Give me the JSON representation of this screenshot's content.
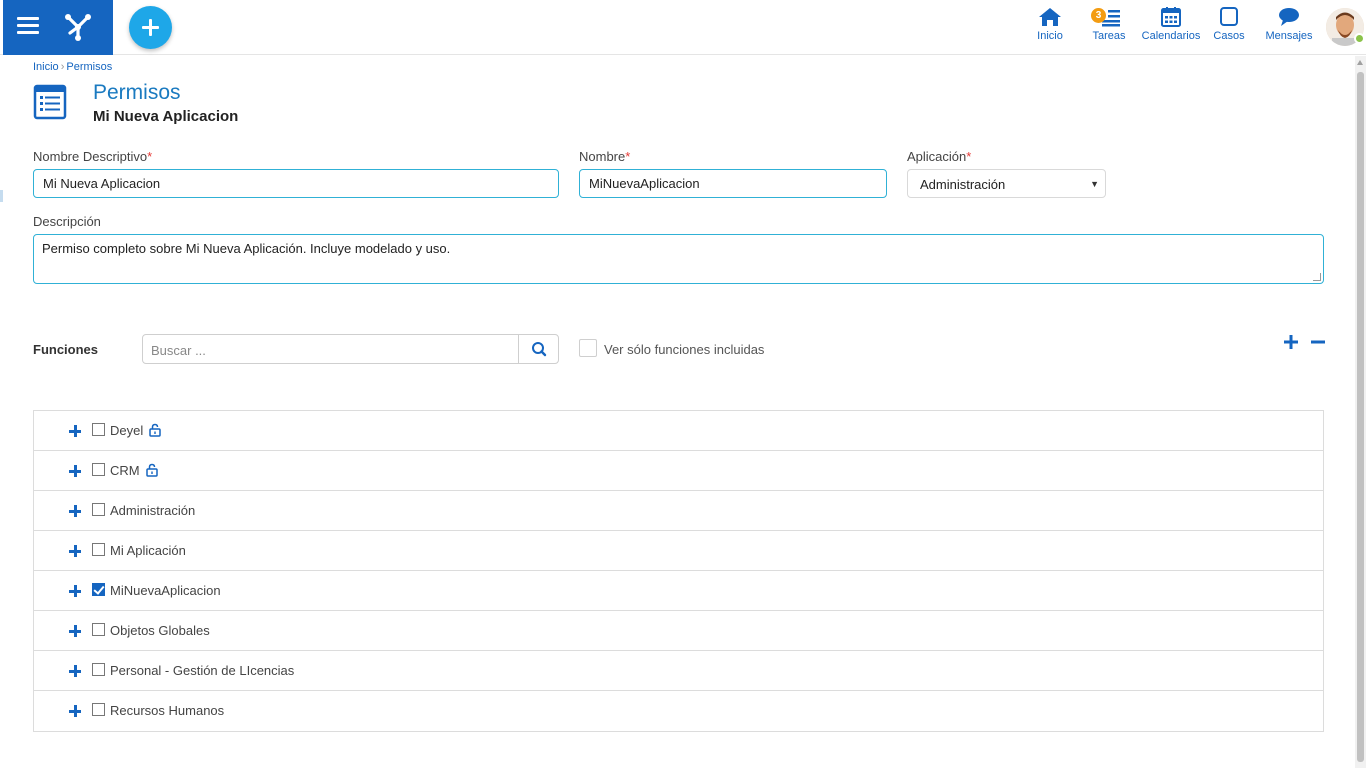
{
  "colors": {
    "primary": "#1565c0",
    "accent": "#1ea7e8",
    "input_border": "#30b1d6",
    "required": "#e53935",
    "badge": "#f39c12",
    "online": "#8bc34a"
  },
  "header": {
    "menu_icon": "hamburger-icon",
    "logo_icon": "deyel-logo",
    "add_icon": "plus-icon",
    "nav": [
      {
        "label": "Inicio",
        "icon": "home-icon"
      },
      {
        "label": "Tareas",
        "icon": "tasks-icon",
        "badge": "3"
      },
      {
        "label": "Calendarios",
        "icon": "calendar-icon"
      },
      {
        "label": "Casos",
        "icon": "cases-icon"
      },
      {
        "label": "Mensajes",
        "icon": "chat-icon"
      }
    ]
  },
  "breadcrumb": {
    "home": "Inicio",
    "separator": "›",
    "current": "Permisos"
  },
  "page": {
    "title": "Permisos",
    "subtitle": "Mi Nueva Aplicacion"
  },
  "form": {
    "nombre_descriptivo": {
      "label": "Nombre Descriptivo",
      "required": "*",
      "value": "Mi Nueva Aplicacion"
    },
    "nombre": {
      "label": "Nombre",
      "required": "*",
      "value": "MiNuevaAplicacion"
    },
    "aplicacion": {
      "label": "Aplicación",
      "required": "*",
      "value": "Administración"
    },
    "descripcion": {
      "label": "Descripción",
      "value": "Permiso completo sobre Mi Nueva Aplicación. Incluye  modelado y uso."
    }
  },
  "funciones": {
    "label": "Funciones",
    "search_placeholder": "Buscar ...",
    "filter_label": "Ver sólo funciones incluidas",
    "filter_checked": false,
    "items": [
      {
        "label": "Deyel",
        "checked": false,
        "locked": true
      },
      {
        "label": "CRM",
        "checked": false,
        "locked": true
      },
      {
        "label": "Administración",
        "checked": false,
        "locked": false
      },
      {
        "label": "Mi Aplicación",
        "checked": false,
        "locked": false
      },
      {
        "label": "MiNuevaAplicacion",
        "checked": true,
        "locked": false
      },
      {
        "label": "Objetos Globales",
        "checked": false,
        "locked": false
      },
      {
        "label": "Personal - Gestión de LIcencias",
        "checked": false,
        "locked": false
      },
      {
        "label": "Recursos Humanos",
        "checked": false,
        "locked": false
      }
    ]
  }
}
